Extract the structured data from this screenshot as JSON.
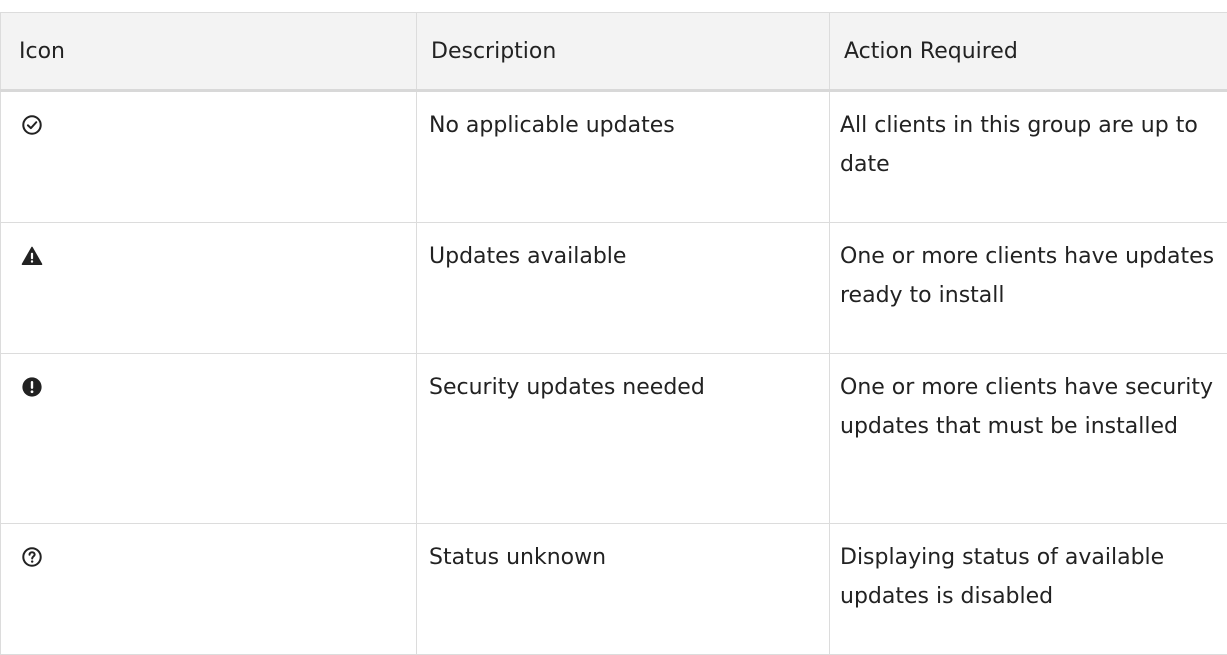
{
  "headers": {
    "icon": "Icon",
    "description": "Description",
    "action": "Action Required"
  },
  "rows": [
    {
      "icon": "check-circle-icon",
      "description": "No applicable updates",
      "action": "All clients in this group are up to date"
    },
    {
      "icon": "warning-triangle-icon",
      "description": "Updates available",
      "action": "One or more clients have updates ready to install"
    },
    {
      "icon": "exclamation-circle-icon",
      "description": "Security updates needed",
      "action": "One or more clients have security updates that must be installed"
    },
    {
      "icon": "question-circle-icon",
      "description": "Status unknown",
      "action": "Displaying status of available updates is disabled"
    }
  ]
}
